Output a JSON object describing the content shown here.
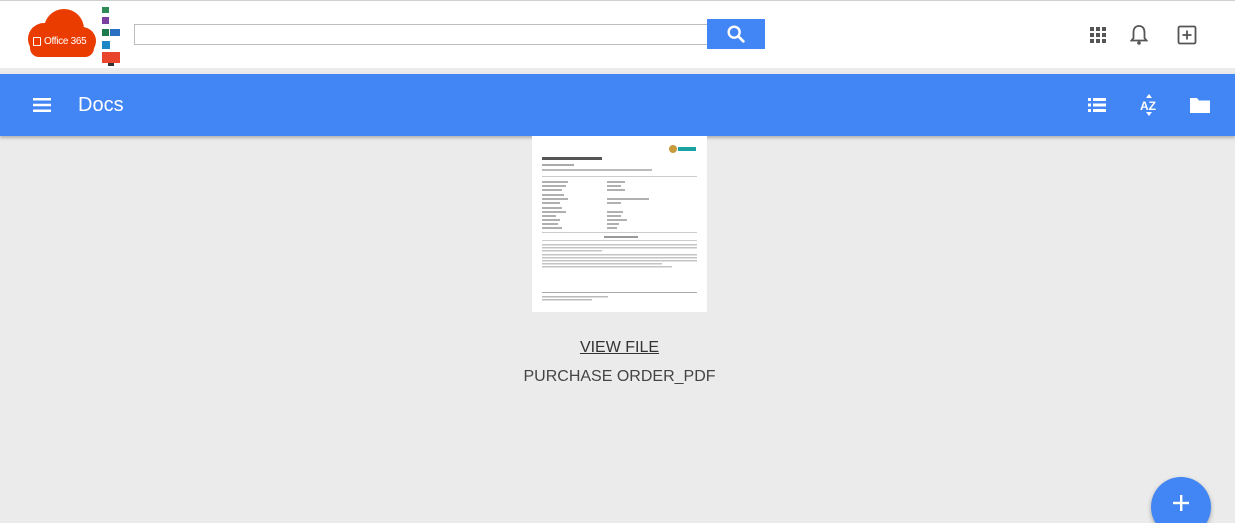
{
  "brand": {
    "logo_text": "Office 365",
    "colors": {
      "cloud": "#eb3c00",
      "primary": "#4285f4"
    }
  },
  "header": {
    "search": {
      "value": "",
      "placeholder": ""
    },
    "icons": [
      "search-icon",
      "apps-icon",
      "bell-icon",
      "add-box-icon"
    ]
  },
  "appbar": {
    "title": "Docs",
    "icons": [
      "menu-icon",
      "list-view-icon",
      "sort-az-icon",
      "folder-icon"
    ]
  },
  "main": {
    "files": [
      {
        "link_label": "VIEW FILE ",
        "name": "PURCHASE ORDER_PDF"
      }
    ]
  },
  "fab": {
    "label": "+"
  }
}
